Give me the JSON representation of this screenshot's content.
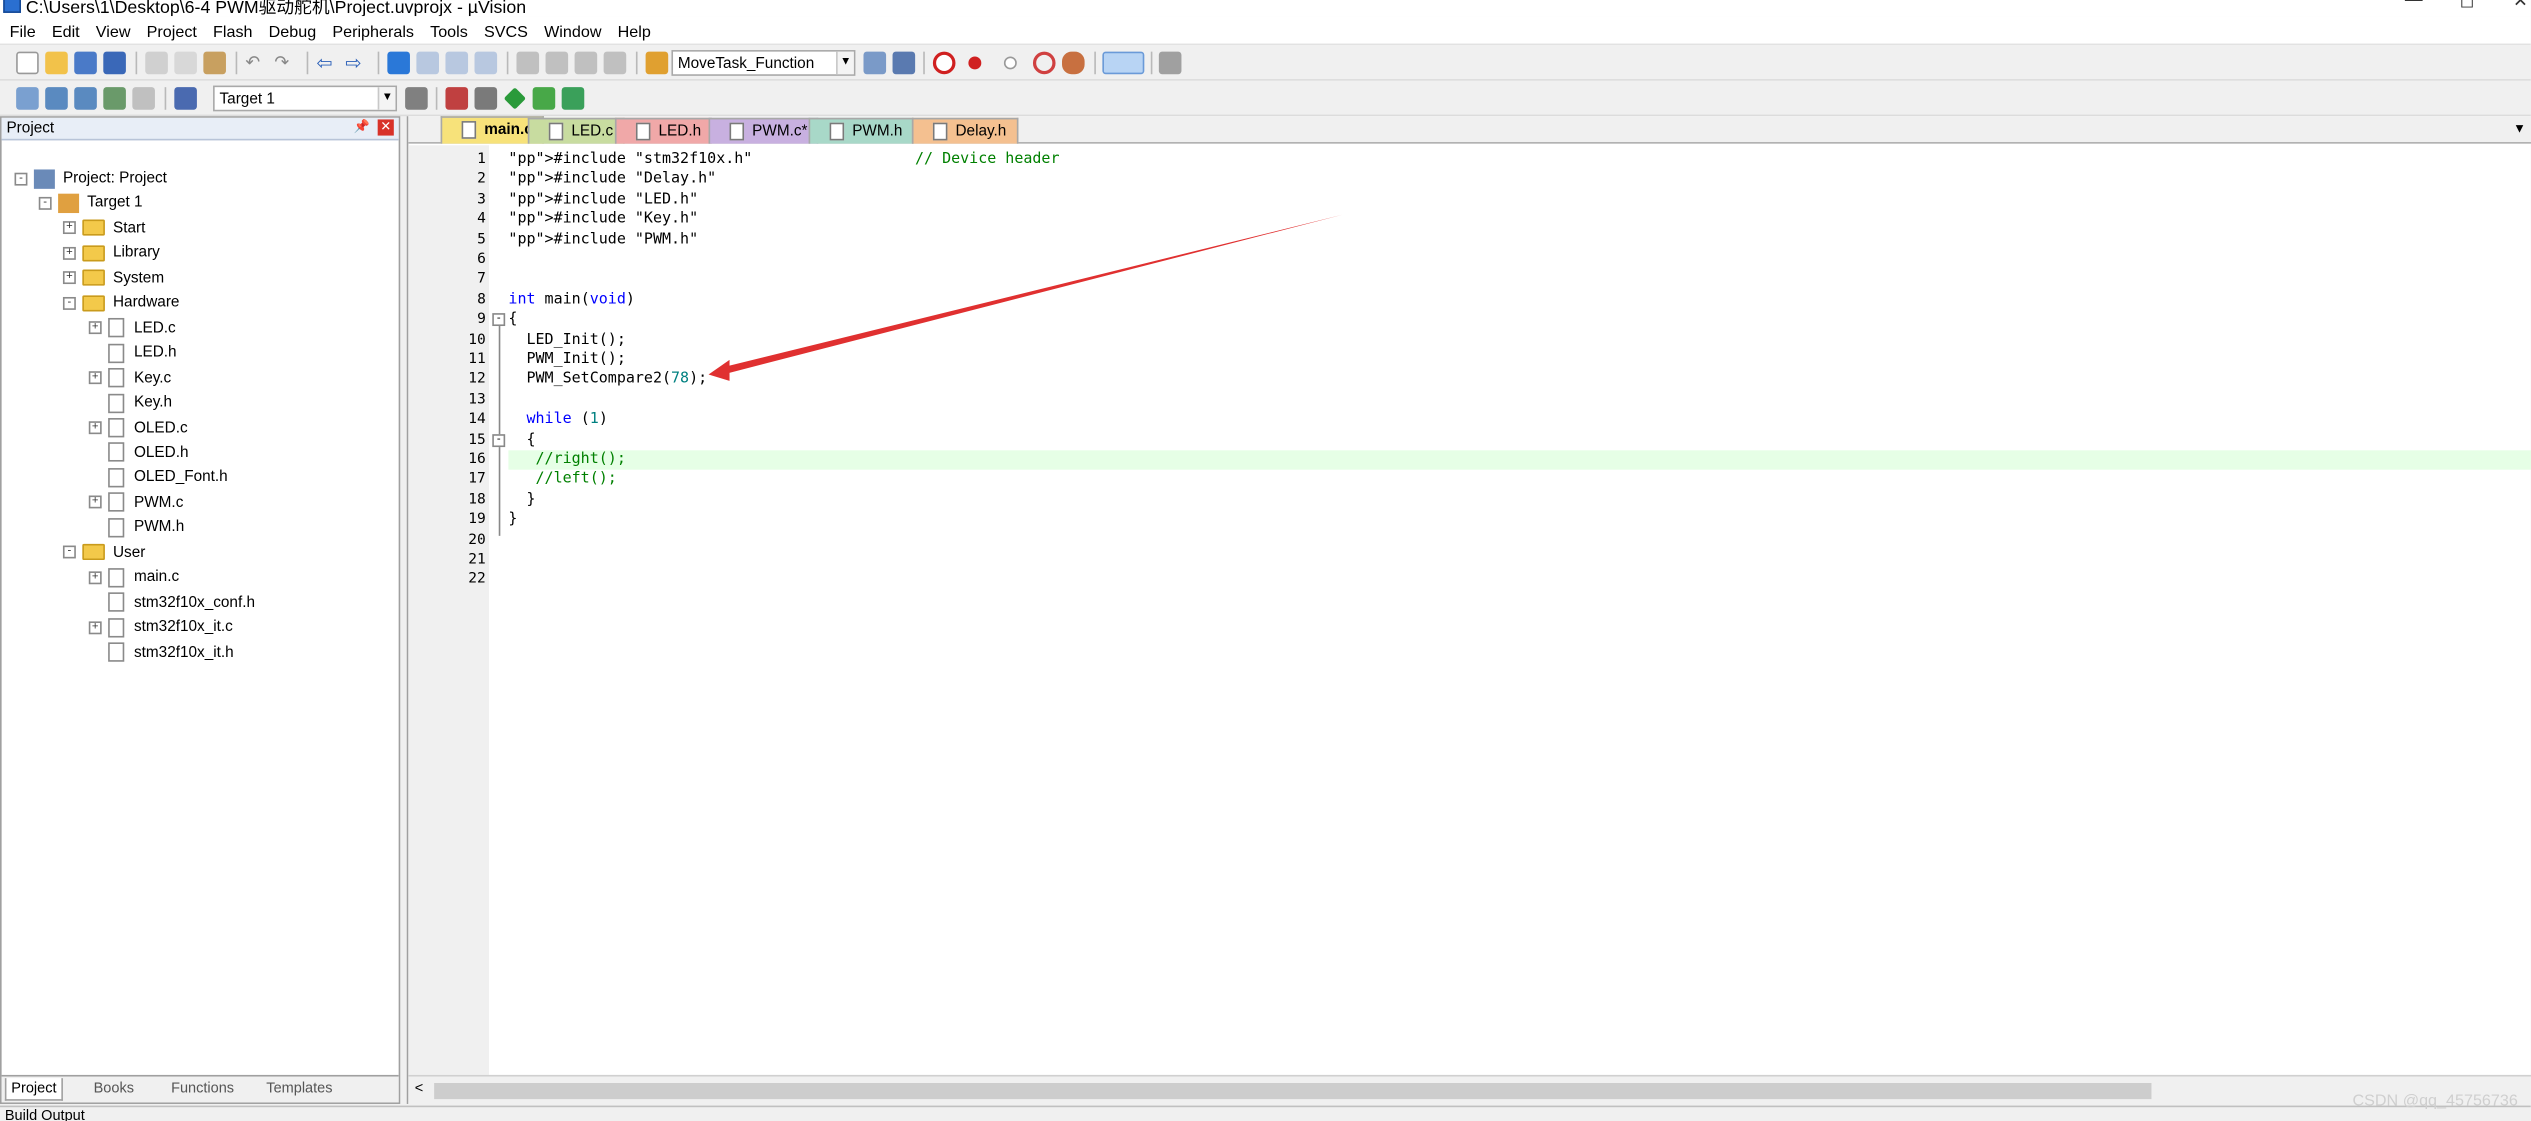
{
  "window": {
    "title": "C:\\Users\\1\\Desktop\\6-4 PWM驱动舵机\\Project.uvprojx - µVision"
  },
  "menu": [
    "File",
    "Edit",
    "View",
    "Project",
    "Flash",
    "Debug",
    "Peripherals",
    "Tools",
    "SVCS",
    "Window",
    "Help"
  ],
  "toolbar": {
    "function_combo": "MoveTask_Function",
    "target_combo": "Target 1"
  },
  "project_pane": {
    "title": "Project",
    "tree": [
      {
        "label": "Project: Project",
        "level": 0,
        "kind": "project",
        "expand": "-"
      },
      {
        "label": "Target 1",
        "level": 1,
        "kind": "target",
        "expand": "-"
      },
      {
        "label": "Start",
        "level": 2,
        "kind": "folder",
        "expand": "+"
      },
      {
        "label": "Library",
        "level": 2,
        "kind": "folder",
        "expand": "+"
      },
      {
        "label": "System",
        "level": 2,
        "kind": "folder",
        "expand": "+"
      },
      {
        "label": "Hardware",
        "level": 2,
        "kind": "folder",
        "expand": "-"
      },
      {
        "label": "LED.c",
        "level": 3,
        "kind": "file",
        "expand": "+"
      },
      {
        "label": "LED.h",
        "level": 3,
        "kind": "file",
        "expand": ""
      },
      {
        "label": "Key.c",
        "level": 3,
        "kind": "file",
        "expand": "+"
      },
      {
        "label": "Key.h",
        "level": 3,
        "kind": "file",
        "expand": ""
      },
      {
        "label": "OLED.c",
        "level": 3,
        "kind": "file",
        "expand": "+"
      },
      {
        "label": "OLED.h",
        "level": 3,
        "kind": "file",
        "expand": ""
      },
      {
        "label": "OLED_Font.h",
        "level": 3,
        "kind": "file",
        "expand": ""
      },
      {
        "label": "PWM.c",
        "level": 3,
        "kind": "file",
        "expand": "+"
      },
      {
        "label": "PWM.h",
        "level": 3,
        "kind": "file",
        "expand": ""
      },
      {
        "label": "User",
        "level": 2,
        "kind": "folder",
        "expand": "-"
      },
      {
        "label": "main.c",
        "level": 3,
        "kind": "file",
        "expand": "+"
      },
      {
        "label": "stm32f10x_conf.h",
        "level": 3,
        "kind": "file",
        "expand": ""
      },
      {
        "label": "stm32f10x_it.c",
        "level": 3,
        "kind": "file",
        "expand": "+"
      },
      {
        "label": "stm32f10x_it.h",
        "level": 3,
        "kind": "file",
        "expand": ""
      }
    ],
    "bottom_tabs": [
      "Project",
      "Books",
      "Functions",
      "Templates"
    ]
  },
  "editor_tabs": [
    {
      "label": "main.c",
      "color": "#f7e27a",
      "active": true
    },
    {
      "label": "LED.c",
      "color": "#c8dca0",
      "active": false
    },
    {
      "label": "LED.h",
      "color": "#f0a8a8",
      "active": false
    },
    {
      "label": "PWM.c*",
      "color": "#c8b0e0",
      "active": false
    },
    {
      "label": "PWM.h",
      "color": "#a8d8c8",
      "active": false
    },
    {
      "label": "Delay.h",
      "color": "#f4c090",
      "active": false
    }
  ],
  "code_lines": [
    "#include \"stm32f10x.h\"                  // Device header",
    "#include \"Delay.h\"",
    "#include \"LED.h\"",
    "#include \"Key.h\"",
    "#include \"PWM.h\"",
    "",
    "",
    "int main(void)",
    "{",
    "  LED_Init();",
    "  PWM_Init();",
    "  PWM_SetCompare2(78);",
    "",
    "  while (1)",
    "  {",
    "   //right();",
    "   //left();",
    "  }",
    "}",
    "",
    "",
    ""
  ],
  "highlighted_line": 16,
  "status_bar": {
    "text": "Build Output"
  },
  "watermark": "CSDN @qq_45756736",
  "colors": {
    "annotation_arrow": "#e03030",
    "current_line": "#e6ffe6"
  }
}
